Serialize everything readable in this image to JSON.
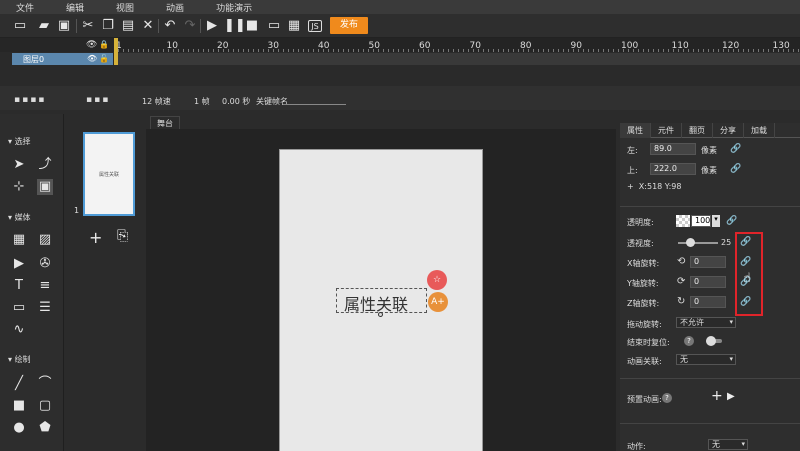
{
  "menu": [
    "文件",
    "编辑",
    "视图",
    "动画",
    "功能演示"
  ],
  "toolbar": {
    "publish_label": "发布",
    "icons": [
      "new-file-icon",
      "open-folder-icon",
      "save-icon",
      "cut-icon",
      "copy-icon",
      "paste-icon",
      "delete-icon",
      "undo-icon",
      "redo-icon",
      "play-icon",
      "pause-icon",
      "stop-icon",
      "preview-icon",
      "qrcode-icon",
      "js-icon"
    ]
  },
  "timeline": {
    "ruler_ticks": [
      "1",
      "10",
      "20",
      "30",
      "40",
      "50",
      "60",
      "70",
      "80",
      "90",
      "100",
      "110",
      "120",
      "130"
    ],
    "layer_name": "图层0",
    "frame_rate": "12 帧速",
    "frame": "1 帧",
    "time": "0.00 秒",
    "keyframe_label": "关键帧名"
  },
  "tools": {
    "sections": [
      "选择",
      "媒体",
      "绘制"
    ]
  },
  "pages": {
    "thumb_text": "属性关联",
    "page_number": "1"
  },
  "stage": {
    "tab": "舞台",
    "text": "属性关联"
  },
  "props": {
    "tabs": [
      "属性",
      "元件",
      "翻页",
      "分享",
      "加载"
    ],
    "left_label": "左:",
    "left_value": "89.0",
    "top_label": "上:",
    "top_value": "222.0",
    "unit": "像素",
    "coords": "X:518   Y:98",
    "opacity_label": "透明度:",
    "opacity_value": "100",
    "perspective_label": "透视度:",
    "perspective_value": "25",
    "x_rot_label": "X轴旋转:",
    "x_rot_value": "0",
    "y_rot_label": "Y轴旋转:",
    "y_rot_value": "0",
    "z_rot_label": "Z轴旋转:",
    "z_rot_value": "0",
    "drag_rot_label": "拖动旋转:",
    "drag_rot_value": "不允许",
    "reset_label": "结束时复位:",
    "anim_link_label": "动画关联:",
    "anim_link_value": "无",
    "preset_label": "预置动画:",
    "action_label": "动作:",
    "action_value": "无"
  }
}
